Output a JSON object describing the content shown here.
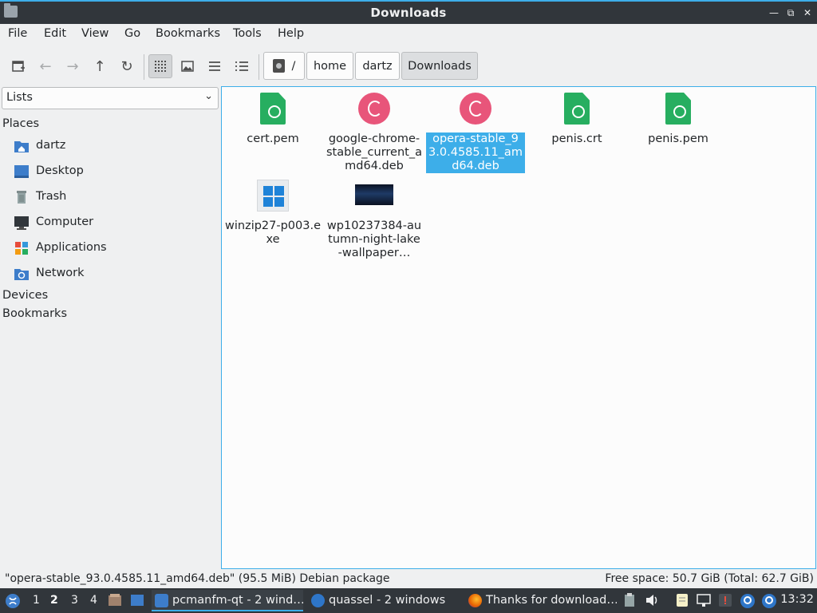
{
  "window": {
    "title": "Downloads"
  },
  "menu": [
    "File",
    "Edit",
    "View",
    "Go",
    "Bookmarks",
    "Tools",
    "Help"
  ],
  "breadcrumb": {
    "root": "/",
    "parts": [
      "home",
      "dartz",
      "Downloads"
    ]
  },
  "sidebar": {
    "select": "Lists",
    "places_label": "Places",
    "places": [
      {
        "label": "dartz",
        "icon": "home-folder-icon"
      },
      {
        "label": "Desktop",
        "icon": "desktop-icon"
      },
      {
        "label": "Trash",
        "icon": "trash-icon"
      },
      {
        "label": "Computer",
        "icon": "computer-icon"
      },
      {
        "label": "Applications",
        "icon": "applications-icon"
      },
      {
        "label": "Network",
        "icon": "network-icon"
      }
    ],
    "devices_label": "Devices",
    "bookmarks_label": "Bookmarks"
  },
  "files": [
    {
      "name": "cert.pem",
      "type": "certificate"
    },
    {
      "name": "google-chrome-stable_current_amd64.deb",
      "type": "debian"
    },
    {
      "name": "opera-stable_93.0.4585.11_amd64.deb",
      "type": "debian",
      "selected": true
    },
    {
      "name": "penis.crt",
      "type": "certificate"
    },
    {
      "name": "penis.pem",
      "type": "certificate"
    },
    {
      "name": "winzip27-p003.exe",
      "type": "windows-exe"
    },
    {
      "name": "wp10237384-autumn-night-lake-wallpaper…",
      "type": "image"
    }
  ],
  "file_labels": {
    "f0": "cert.pem",
    "f1": "google-chrome-stable_current_amd64.deb",
    "f2": "opera-stable_93.0.4585.11_amd64.deb",
    "f3": "penis.crt",
    "f4": "penis.pem",
    "f5": "winzip27-p003.exe",
    "f6": "wp10237384-autumn-night-lake-wallpaper…"
  },
  "status": {
    "left": "\"opera-stable_93.0.4585.11_amd64.deb\" (95.5 MiB) Debian package",
    "right": "Free space: 50.7 GiB (Total: 62.7 GiB)"
  },
  "taskbar": {
    "desktops": [
      "1",
      "2",
      "3",
      "4"
    ],
    "active_desktop": "2",
    "tasks": [
      {
        "label": "pcmanfm-qt - 2 wind…",
        "active": true
      },
      {
        "label": "quassel - 2 windows"
      },
      {
        "label": "Thanks for download…"
      }
    ],
    "clock": "13:32"
  },
  "colors": {
    "accent": "#3daee9",
    "titlebar": "#31363b",
    "certificate": "#27ae60",
    "debian": "#e8557a"
  }
}
